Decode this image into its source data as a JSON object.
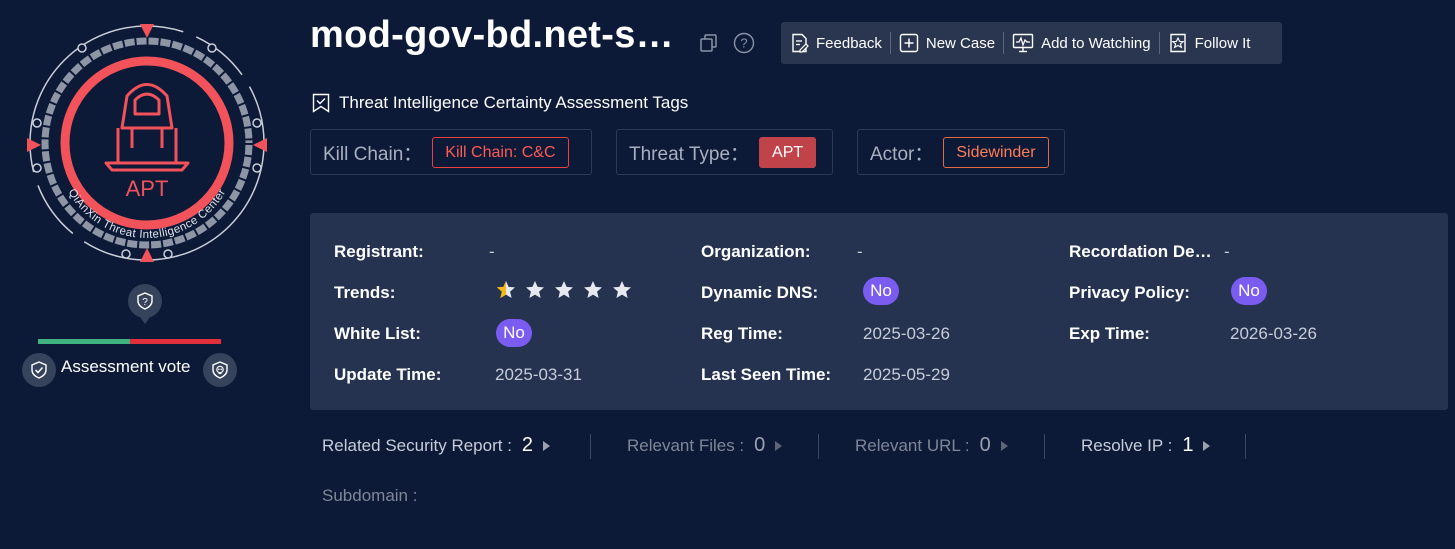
{
  "badge": {
    "main_text": "APT",
    "ring_text": "QiAnXin Threat Intelligence Center",
    "vote_label": "Assessment vote",
    "vote_ratio_positive": 0.5
  },
  "header": {
    "domain": "mod-gov-bd.net-s…",
    "toolbar": {
      "feedback": "Feedback",
      "new_case": "New Case",
      "add_watching": "Add to Watching",
      "follow": "Follow It"
    }
  },
  "tags": {
    "heading": "Threat Intelligence Certainty Assessment Tags",
    "groups": [
      {
        "label": "Kill Chain：",
        "value": "Kill Chain: C&C"
      },
      {
        "label": "Threat Type：",
        "value": "APT"
      },
      {
        "label": "Actor：",
        "value": "Sidewinder"
      }
    ]
  },
  "info": {
    "registrant": {
      "label": "Registrant:",
      "value": "-"
    },
    "organization": {
      "label": "Organization:",
      "value": "-"
    },
    "recordation": {
      "label": "Recordation De…",
      "value": "-"
    },
    "trends": {
      "label": "Trends:",
      "rating": 0.5,
      "max": 5
    },
    "dynamic_dns": {
      "label": "Dynamic DNS:",
      "value": "No"
    },
    "privacy_policy": {
      "label": "Privacy Policy:",
      "value": "No"
    },
    "white_list": {
      "label": "White List:",
      "value": "No"
    },
    "reg_time": {
      "label": "Reg Time:",
      "value": "2025-03-26"
    },
    "exp_time": {
      "label": "Exp Time:",
      "value": "2026-03-26"
    },
    "update_time": {
      "label": "Update Time:",
      "value": "2025-03-31"
    },
    "last_seen": {
      "label": "Last Seen Time:",
      "value": "2025-05-29"
    }
  },
  "related": {
    "security_report": {
      "label": "Related Security Report :",
      "count": "2"
    },
    "files": {
      "label": "Relevant Files :",
      "count": "0"
    },
    "url": {
      "label": "Relevant URL :",
      "count": "0"
    },
    "resolve_ip": {
      "label": "Resolve IP :",
      "count": "1"
    },
    "subdomain": {
      "label": "Subdomain :"
    }
  },
  "colors": {
    "background": "#0c1a38",
    "panel": "#253350",
    "accent_red": "#f2525a",
    "pill_purple": "#7b5cf0",
    "star_gold": "#f2b90f"
  }
}
